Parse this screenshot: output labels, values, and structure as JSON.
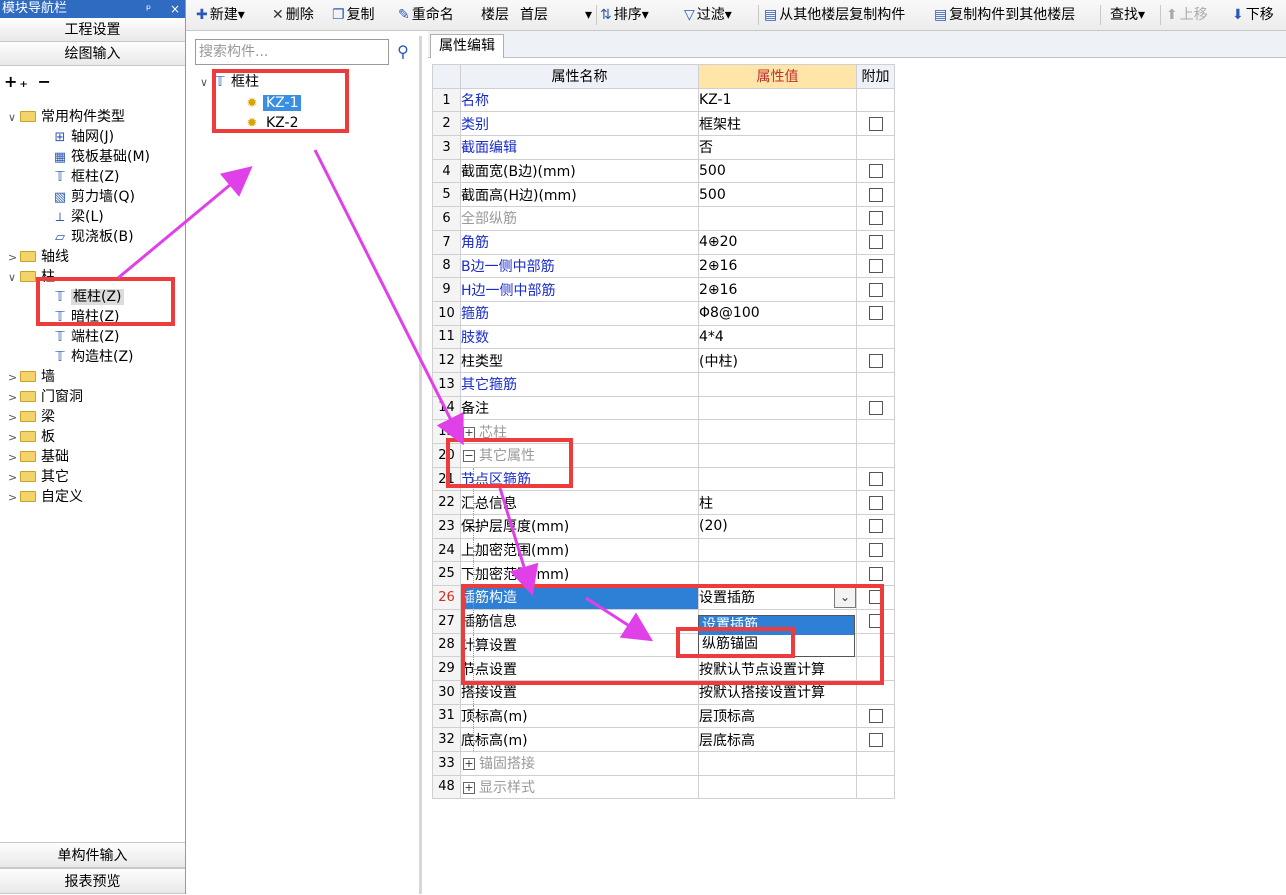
{
  "nav": {
    "title": "模块导航栏",
    "pin": "ᵖ",
    "close": "×",
    "buttons": [
      "工程设置",
      "绘图输入"
    ],
    "tools": "+₊ −",
    "tree": [
      {
        "label": "常用构件类型",
        "kind": "folder",
        "exp": "∨"
      },
      {
        "label": "轴网(J)",
        "kind": "grid-icon"
      },
      {
        "label": "筏板基础(M)",
        "kind": "raft-icon"
      },
      {
        "label": "框柱(Z)",
        "kind": "column-icon"
      },
      {
        "label": "剪力墙(Q)",
        "kind": "wall-icon"
      },
      {
        "label": "梁(L)",
        "kind": "beam-icon"
      },
      {
        "label": "现浇板(B)",
        "kind": "slab-icon"
      },
      {
        "label": "轴线",
        "kind": "folder",
        "exp": ">"
      },
      {
        "label": "柱",
        "kind": "folder",
        "exp": "∨"
      },
      {
        "label": "框柱(Z)",
        "kind": "column-icon",
        "selected": true
      },
      {
        "label": "暗柱(Z)",
        "kind": "column-icon"
      },
      {
        "label": "端柱(Z)",
        "kind": "column-icon"
      },
      {
        "label": "构造柱(Z)",
        "kind": "column-icon"
      },
      {
        "label": "墙",
        "kind": "folder",
        "exp": ">"
      },
      {
        "label": "门窗洞",
        "kind": "folder",
        "exp": ">"
      },
      {
        "label": "梁",
        "kind": "folder",
        "exp": ">"
      },
      {
        "label": "板",
        "kind": "folder",
        "exp": ">"
      },
      {
        "label": "基础",
        "kind": "folder",
        "exp": ">"
      },
      {
        "label": "其它",
        "kind": "folder",
        "exp": ">"
      },
      {
        "label": "自定义",
        "kind": "folder",
        "exp": ">"
      }
    ],
    "bottom": [
      "单构件输入",
      "报表预览"
    ]
  },
  "toolbar": {
    "new": "新建",
    "delete": "删除",
    "copy": "复制",
    "rename": "重命名",
    "floor_label": "楼层",
    "floor_value": "首层",
    "sort": "排序",
    "filter": "过滤",
    "copy_from": "从其他楼层复制构件",
    "copy_to": "复制构件到其他楼层",
    "find": "查找",
    "up": "上移",
    "down": "下移"
  },
  "components": {
    "placeholder": "搜索构件...",
    "root": "框柱",
    "items": [
      "KZ-1",
      "KZ-2"
    ]
  },
  "tab": "属性编辑",
  "grid": {
    "headers": [
      "属性名称",
      "属性值",
      "附加"
    ],
    "rows": [
      {
        "n": "1",
        "name": "名称",
        "value": "KZ-1",
        "color": "blue",
        "cb": false
      },
      {
        "n": "2",
        "name": "类别",
        "value": "框架柱",
        "color": "blue",
        "cb": true
      },
      {
        "n": "3",
        "name": "截面编辑",
        "value": "否",
        "color": "blue",
        "cb": false
      },
      {
        "n": "4",
        "name": "截面宽(B边)(mm)",
        "value": "500",
        "color": "black",
        "cb": true
      },
      {
        "n": "5",
        "name": "截面高(H边)(mm)",
        "value": "500",
        "color": "black",
        "cb": true
      },
      {
        "n": "6",
        "name": "全部纵筋",
        "value": "",
        "color": "gray",
        "cb": true
      },
      {
        "n": "7",
        "name": "角筋",
        "value": "4⊕20",
        "color": "blue",
        "cb": true
      },
      {
        "n": "8",
        "name": "B边一侧中部筋",
        "value": "2⊕16",
        "color": "blue",
        "cb": true
      },
      {
        "n": "9",
        "name": "H边一侧中部筋",
        "value": "2⊕16",
        "color": "blue",
        "cb": true
      },
      {
        "n": "10",
        "name": "箍筋",
        "value": "Φ8@100",
        "color": "blue",
        "cb": true
      },
      {
        "n": "11",
        "name": "肢数",
        "value": "4*4",
        "color": "blue",
        "cb": false
      },
      {
        "n": "12",
        "name": "柱类型",
        "value": "(中柱)",
        "color": "black",
        "cb": true
      },
      {
        "n": "13",
        "name": "其它箍筋",
        "value": "",
        "color": "blue",
        "cb": false
      },
      {
        "n": "14",
        "name": "备注",
        "value": "",
        "color": "black",
        "cb": true
      },
      {
        "n": "15",
        "name": "芯柱",
        "value": "",
        "color": "gray",
        "cb": false,
        "group": "+"
      },
      {
        "n": "20",
        "name": "其它属性",
        "value": "",
        "color": "gray",
        "cb": false,
        "group": "−"
      },
      {
        "n": "21",
        "name": "节点区箍筋",
        "value": "",
        "color": "blue",
        "cb": true,
        "indent": true
      },
      {
        "n": "22",
        "name": "汇总信息",
        "value": "柱",
        "color": "black",
        "cb": true,
        "indent": true
      },
      {
        "n": "23",
        "name": "保护层厚度(mm)",
        "value": "(20)",
        "color": "black",
        "cb": true,
        "indent": true
      },
      {
        "n": "24",
        "name": "上加密范围(mm)",
        "value": "",
        "color": "black",
        "cb": true,
        "indent": true
      },
      {
        "n": "25",
        "name": "下加密范围(mm)",
        "value": "",
        "color": "black",
        "cb": true,
        "indent": true
      },
      {
        "n": "26",
        "name": "插筋构造",
        "value": "设置插筋",
        "color": "black",
        "cb": true,
        "indent": true,
        "selected": true,
        "dropdown": true
      },
      {
        "n": "27",
        "name": "插筋信息",
        "value": "",
        "color": "black",
        "cb": true,
        "indent": true
      },
      {
        "n": "28",
        "name": "计算设置",
        "value": "按默认计算设置计算",
        "color": "black",
        "cb": false,
        "indent": true
      },
      {
        "n": "29",
        "name": "节点设置",
        "value": "按默认节点设置计算",
        "color": "black",
        "cb": false,
        "indent": true
      },
      {
        "n": "30",
        "name": "搭接设置",
        "value": "按默认搭接设置计算",
        "color": "black",
        "cb": false,
        "indent": true
      },
      {
        "n": "31",
        "name": "顶标高(m)",
        "value": "层顶标高",
        "color": "black",
        "cb": true,
        "indent": true
      },
      {
        "n": "32",
        "name": "底标高(m)",
        "value": "层底标高",
        "color": "black",
        "cb": true,
        "indent": true
      },
      {
        "n": "33",
        "name": "锚固搭接",
        "value": "",
        "color": "gray",
        "cb": false,
        "group": "+"
      },
      {
        "n": "48",
        "name": "显示样式",
        "value": "",
        "color": "gray",
        "cb": false,
        "group": "+"
      }
    ],
    "dropdown_options": [
      "设置插筋",
      "纵筋锚固"
    ]
  },
  "colors": {
    "annotation": "#ee3b3b",
    "arrow": "#e040e8",
    "selection": "#2e7fd6"
  }
}
